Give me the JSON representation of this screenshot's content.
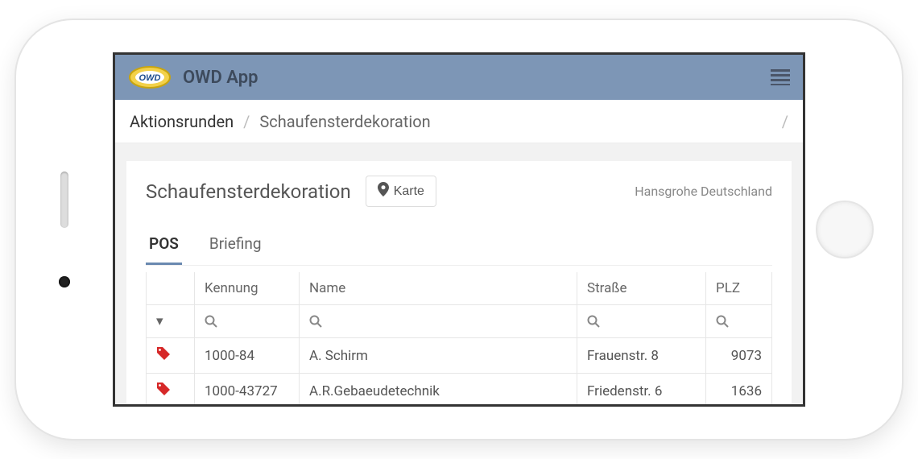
{
  "header": {
    "app_title": "OWD App",
    "logo_text": "OWD"
  },
  "breadcrumb": {
    "items": [
      "Aktionsrunden",
      "Schaufensterdekoration"
    ]
  },
  "page": {
    "title": "Schaufensterdekoration",
    "map_button": "Karte",
    "client": "Hansgrohe Deutschland"
  },
  "tabs": [
    {
      "label": "POS",
      "active": true
    },
    {
      "label": "Briefing",
      "active": false
    }
  ],
  "table": {
    "columns": [
      "",
      "Kennung",
      "Name",
      "Straße",
      "PLZ"
    ],
    "rows": [
      {
        "id": "1000-84",
        "name": "A. Schirm",
        "street": "Frauenstr. 8",
        "plz": "9073"
      },
      {
        "id": "1000-43727",
        "name": "A.R.Gebaeudetechnik",
        "street": "Friedenstr. 6",
        "plz": "1636"
      }
    ]
  }
}
